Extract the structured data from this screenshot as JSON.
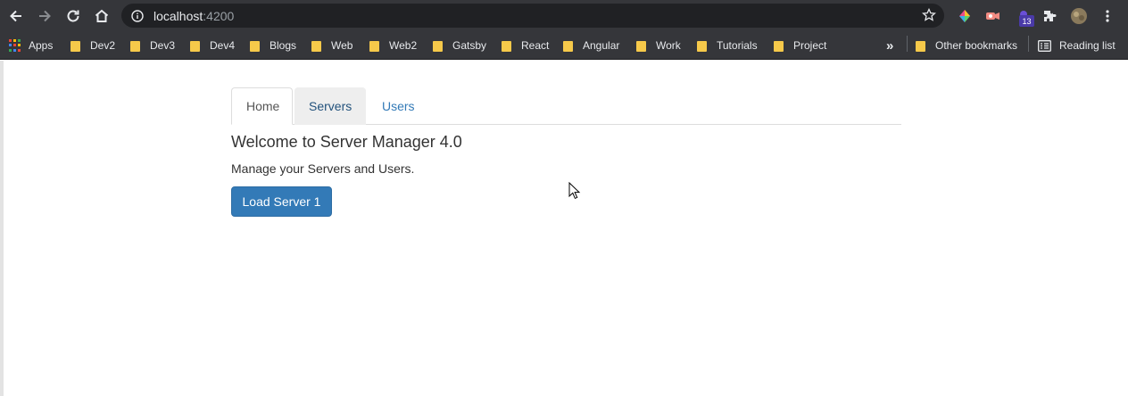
{
  "browser": {
    "url_host": "localhost",
    "url_port": ":4200",
    "extension_badge": "13"
  },
  "bookmarks": {
    "apps_label": "Apps",
    "items": [
      "Dev2",
      "Dev3",
      "Dev4",
      "Blogs",
      "Web",
      "Web2",
      "Gatsby",
      "React",
      "Angular",
      "Work",
      "Tutorials",
      "Project"
    ],
    "overflow_label": "»",
    "other_label": "Other bookmarks",
    "reading_list_label": "Reading list"
  },
  "app": {
    "tabs": [
      {
        "label": "Home",
        "active": true
      },
      {
        "label": "Servers",
        "active": false
      },
      {
        "label": "Users",
        "active": false
      }
    ],
    "heading": "Welcome to Server Manager 4.0",
    "subtext": "Manage your Servers and Users.",
    "load_button_label": "Load Server 1"
  },
  "colors": {
    "chrome_bg": "#35363a",
    "omnibox_bg": "#202124",
    "folder": "#f6c94a",
    "primary_button": "#337ab7",
    "link": "#337ab7"
  }
}
